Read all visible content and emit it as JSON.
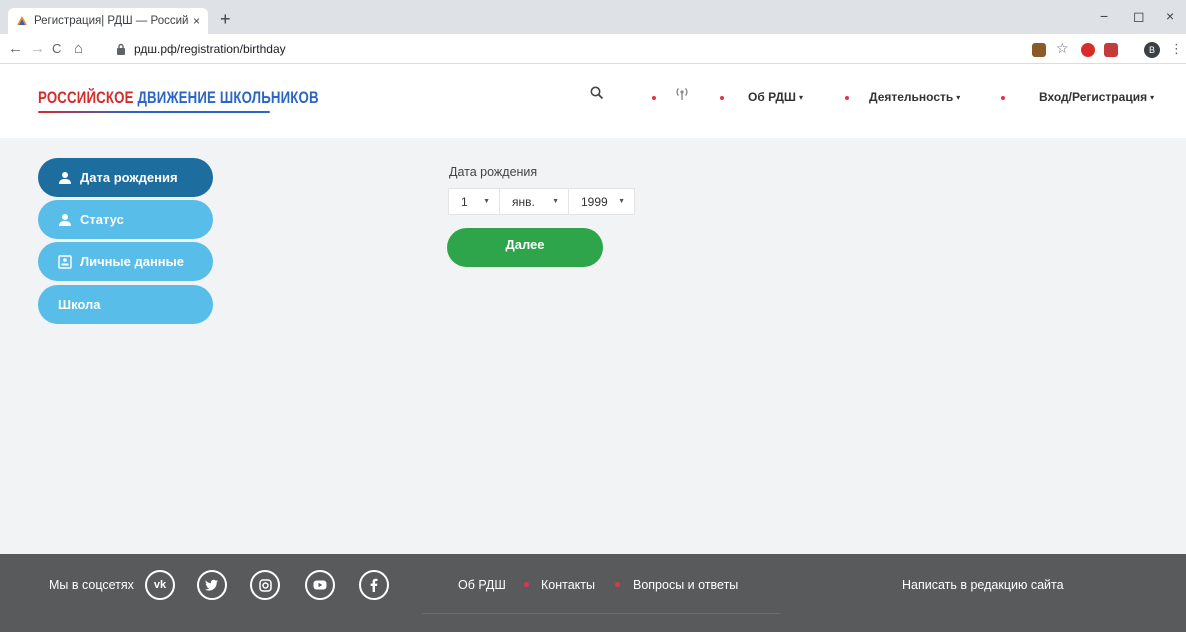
{
  "browser": {
    "tab_title": "Регистрация| РДШ — Российск",
    "tab_close": "×",
    "new_tab": "+",
    "url": "рдш.рф/registration/birthday",
    "profile_initial": "В",
    "nav_back": "←",
    "nav_forward": "→",
    "nav_reload": "C",
    "nav_home": "⌂",
    "win_minimize": "−",
    "win_restore": "◻",
    "win_close": "×"
  },
  "header": {
    "logo_word1": "РОССИЙСКОЕ",
    "logo_word2": "ДВИЖЕНИЕ",
    "logo_word3": "ШКОЛЬНИКОВ",
    "nav": {
      "about": "Об РДШ",
      "activity": "Деятельность",
      "login": "Вход/Регистрация"
    },
    "caret": "▾"
  },
  "sidebar": {
    "items": [
      {
        "label": "Дата рождения",
        "icon": "user-icon",
        "state": "active"
      },
      {
        "label": "Статус",
        "icon": "user-icon",
        "state": "inactive"
      },
      {
        "label": "Личные данные",
        "icon": "id-card-icon",
        "state": "inactive"
      },
      {
        "label": "Школа",
        "icon": "",
        "state": "inactive"
      }
    ]
  },
  "form": {
    "dob_label": "Дата рождения",
    "day": "1",
    "month": "янв.",
    "year": "1999",
    "select_arrow": "▼",
    "next_button": "Далее"
  },
  "footer": {
    "social_label": "Мы в соцсетях",
    "social_icons": [
      "vk-icon",
      "twitter-icon",
      "instagram-icon",
      "youtube-icon",
      "facebook-icon"
    ],
    "links": [
      "Об РДШ",
      "Контакты",
      "Вопросы и ответы"
    ],
    "write_link": "Написать в редакцию сайта"
  },
  "colors": {
    "active_item": "#1e6d9f",
    "inactive_item": "#59bde9",
    "next_button": "#2ea54a",
    "footer_bg": "#585a5c",
    "accent_dot": "#e3344b",
    "logo_red": "#d42b2b",
    "logo_blue": "#2b65c6"
  }
}
